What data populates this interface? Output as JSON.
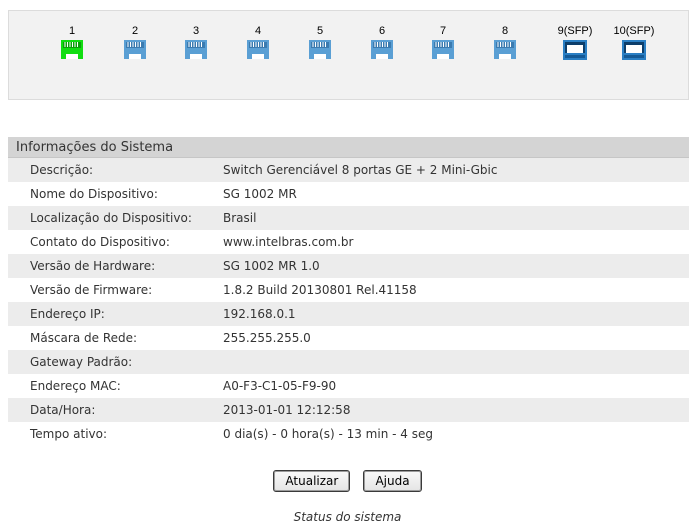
{
  "ports": {
    "rj45": [
      {
        "number": "1",
        "status": "active",
        "color": "#11dd11"
      },
      {
        "number": "2",
        "status": "inactive",
        "color": "#5a9fd4"
      },
      {
        "number": "3",
        "status": "inactive",
        "color": "#5a9fd4"
      },
      {
        "number": "4",
        "status": "inactive",
        "color": "#5a9fd4"
      },
      {
        "number": "5",
        "status": "inactive",
        "color": "#5a9fd4"
      },
      {
        "number": "6",
        "status": "inactive",
        "color": "#5a9fd4"
      },
      {
        "number": "7",
        "status": "inactive",
        "color": "#5a9fd4"
      },
      {
        "number": "8",
        "status": "inactive",
        "color": "#5a9fd4"
      }
    ],
    "sfp": [
      {
        "number": "9(SFP)",
        "status": "inactive",
        "color": "#2a7fc4"
      },
      {
        "number": "10(SFP)",
        "status": "inactive",
        "color": "#2a7fc4"
      }
    ]
  },
  "system_info": {
    "title": "Informações do Sistema",
    "rows": [
      {
        "label": "Descrição:",
        "value": "Switch Gerenciável 8 portas GE + 2 Mini-Gbic"
      },
      {
        "label": "Nome do Dispositivo:",
        "value": "SG 1002 MR"
      },
      {
        "label": "Localização do Dispositivo:",
        "value": "Brasil"
      },
      {
        "label": "Contato do Dispositivo:",
        "value": "www.intelbras.com.br"
      },
      {
        "label": "Versão de Hardware:",
        "value": "SG 1002 MR 1.0"
      },
      {
        "label": "Versão de Firmware:",
        "value": "1.8.2 Build 20130801 Rel.41158"
      },
      {
        "label": "Endereço IP:",
        "value": "192.168.0.1"
      },
      {
        "label": "Máscara de Rede:",
        "value": "255.255.255.0"
      },
      {
        "label": "Gateway Padrão:",
        "value": ""
      },
      {
        "label": "Endereço MAC:",
        "value": "A0-F3-C1-05-F9-90"
      },
      {
        "label": "Data/Hora:",
        "value": "2013-01-01 12:12:58"
      },
      {
        "label": "Tempo ativo:",
        "value": "0 dia(s) - 0 hora(s) - 13 min - 4 seg"
      }
    ]
  },
  "buttons": {
    "refresh_label": "Atualizar",
    "help_label": "Ajuda"
  },
  "caption": "Status do sistema"
}
